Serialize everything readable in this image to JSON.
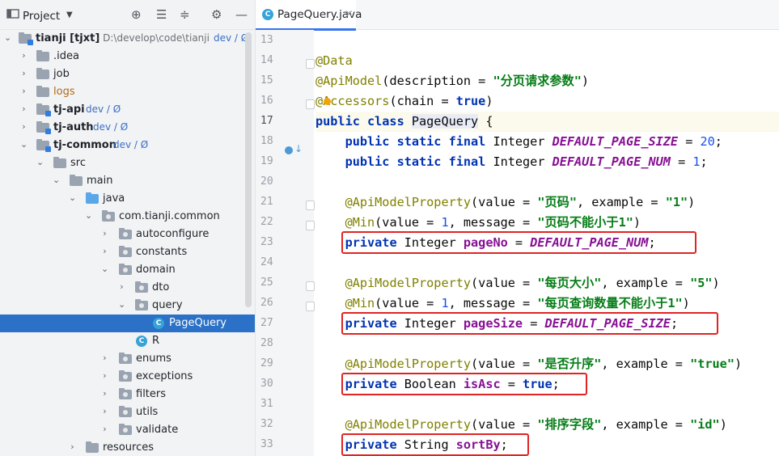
{
  "project_panel": {
    "title": "Project",
    "icons": [
      "target-icon",
      "expand-all-icon",
      "collapse-all-icon",
      "gear-icon",
      "minimize-icon"
    ],
    "tree": [
      {
        "label": "tianji [tjxt]",
        "path": "- D:\\develop\\code\\tianji",
        "branch": "dev / Ø",
        "bold": true
      },
      {
        "label": ".idea"
      },
      {
        "label": "job"
      },
      {
        "label": "logs"
      },
      {
        "label": "tj-api",
        "branch": "dev / Ø",
        "bold": true
      },
      {
        "label": "tj-auth",
        "branch": "dev / Ø",
        "bold": true
      },
      {
        "label": "tj-common",
        "branch": "dev / Ø",
        "bold": true
      },
      {
        "label": "src"
      },
      {
        "label": "main"
      },
      {
        "label": "java"
      },
      {
        "label": "com.tianji.common"
      },
      {
        "label": "autoconfigure"
      },
      {
        "label": "constants"
      },
      {
        "label": "domain"
      },
      {
        "label": "dto"
      },
      {
        "label": "query"
      },
      {
        "label": "PageQuery"
      },
      {
        "label": "R"
      },
      {
        "label": "enums"
      },
      {
        "label": "exceptions"
      },
      {
        "label": "filters"
      },
      {
        "label": "utils"
      },
      {
        "label": "validate"
      },
      {
        "label": "resources"
      }
    ]
  },
  "editor": {
    "tab": {
      "name": "PageQuery.java",
      "icon": "class-icon"
    },
    "line_numbers": [
      "13",
      "14",
      "15",
      "16",
      "17",
      "18",
      "19",
      "20",
      "21",
      "22",
      "23",
      "24",
      "25",
      "26",
      "27",
      "28",
      "29",
      "30",
      "31",
      "32",
      "33"
    ],
    "current_line": "17",
    "code": {
      "l14": {
        "ann": "@Data"
      },
      "l15": {
        "ann": "@ApiModel",
        "p1": "(description = ",
        "str": "\"分页请求参数\"",
        "p2": ")"
      },
      "l16": {
        "ann": "@Accessors",
        "p1": "(chain = ",
        "kw": "true",
        "p2": ")"
      },
      "l17": {
        "kw": "public class ",
        "name": "PageQuery",
        "rest": " {"
      },
      "l18": {
        "kw": "public static final ",
        "type": "Integer ",
        "const": "DEFAULT_PAGE_SIZE",
        "eq": " = ",
        "num": "20",
        "end": ";"
      },
      "l19": {
        "kw": "public static final ",
        "type": "Integer ",
        "const": "DEFAULT_PAGE_NUM",
        "eq": " = ",
        "num": "1",
        "end": ";"
      },
      "l21": {
        "ann": "@ApiModelProperty",
        "p1": "(value = ",
        "s1": "\"页码\"",
        "p2": ", example = ",
        "s2": "\"1\"",
        "p3": ")"
      },
      "l22": {
        "ann": "@Min",
        "p1": "(value = ",
        "num": "1",
        "p2": ", message = ",
        "s1": "\"页码不能小于1\"",
        "p3": ")"
      },
      "l23": {
        "kw": "private ",
        "type": "Integer ",
        "field": "pageNo",
        "eq": " = ",
        "const": "DEFAULT_PAGE_NUM",
        "end": ";"
      },
      "l25": {
        "ann": "@ApiModelProperty",
        "p1": "(value = ",
        "s1": "\"每页大小\"",
        "p2": ", example = ",
        "s2": "\"5\"",
        "p3": ")"
      },
      "l26": {
        "ann": "@Min",
        "p1": "(value = ",
        "num": "1",
        "p2": ", message = ",
        "s1": "\"每页查询数量不能小于1\"",
        "p3": ")"
      },
      "l27": {
        "kw": "private ",
        "type": "Integer ",
        "field": "pageSize",
        "eq": " = ",
        "const": "DEFAULT_PAGE_SIZE",
        "end": ";"
      },
      "l29": {
        "ann": "@ApiModelProperty",
        "p1": "(value = ",
        "s1": "\"是否升序\"",
        "p2": ", example = ",
        "s2": "\"true\"",
        "p3": ")"
      },
      "l30": {
        "kw": "private ",
        "type": "Boolean ",
        "field": "isAsc",
        "eq": " = ",
        "kw2": "true",
        "end": ";"
      },
      "l32": {
        "ann": "@ApiModelProperty",
        "p1": "(value = ",
        "s1": "\"排序字段\"",
        "p2": ", example = ",
        "s2": "\"id\"",
        "p3": ")"
      },
      "l33": {
        "kw": "private ",
        "type": "String ",
        "field": "sortBy",
        "end": ";"
      }
    }
  },
  "colors": {
    "accent": "#2a71c7",
    "highlight_box": "#e02424",
    "keyword": "#0033b3",
    "string": "#067d17",
    "annotation": "#808000",
    "field": "#871094"
  }
}
